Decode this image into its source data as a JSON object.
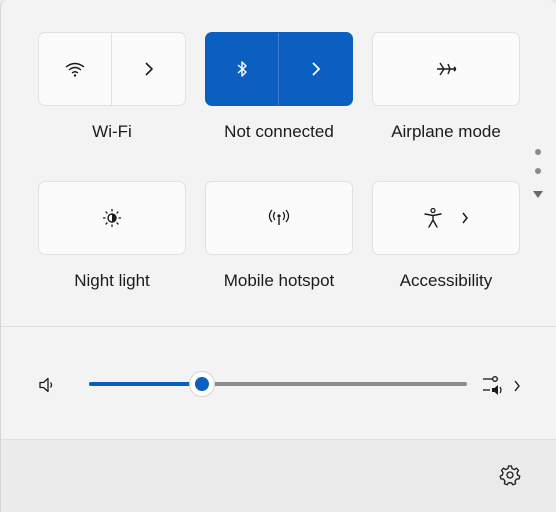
{
  "quick_settings": {
    "row1": [
      {
        "id": "wifi",
        "label": "Wi-Fi",
        "icon": "wifi-icon",
        "state": "off"
      },
      {
        "id": "bluetooth",
        "label": "Not connected",
        "icon": "bluetooth-icon",
        "state": "on"
      },
      {
        "id": "airplane",
        "label": "Airplane mode",
        "icon": "airplane-icon",
        "state": "off"
      }
    ],
    "row2": [
      {
        "id": "night_light",
        "label": "Night light",
        "icon": "brightness-icon",
        "state": "off"
      },
      {
        "id": "mobile_hotspot",
        "label": "Mobile hotspot",
        "icon": "hotspot-icon",
        "state": "off"
      },
      {
        "id": "accessibility",
        "label": "Accessibility",
        "icon": "accessibility-icon",
        "state": "off"
      }
    ]
  },
  "volume": {
    "level_percent": 30,
    "icon": "speaker-icon",
    "output_icon": "audio-output-icon"
  },
  "footer": {
    "settings_icon": "gear-icon"
  },
  "colors": {
    "accent": "#0a5fc0",
    "tile_bg": "#fbfbfb",
    "panel_bg": "#f3f3f3"
  }
}
